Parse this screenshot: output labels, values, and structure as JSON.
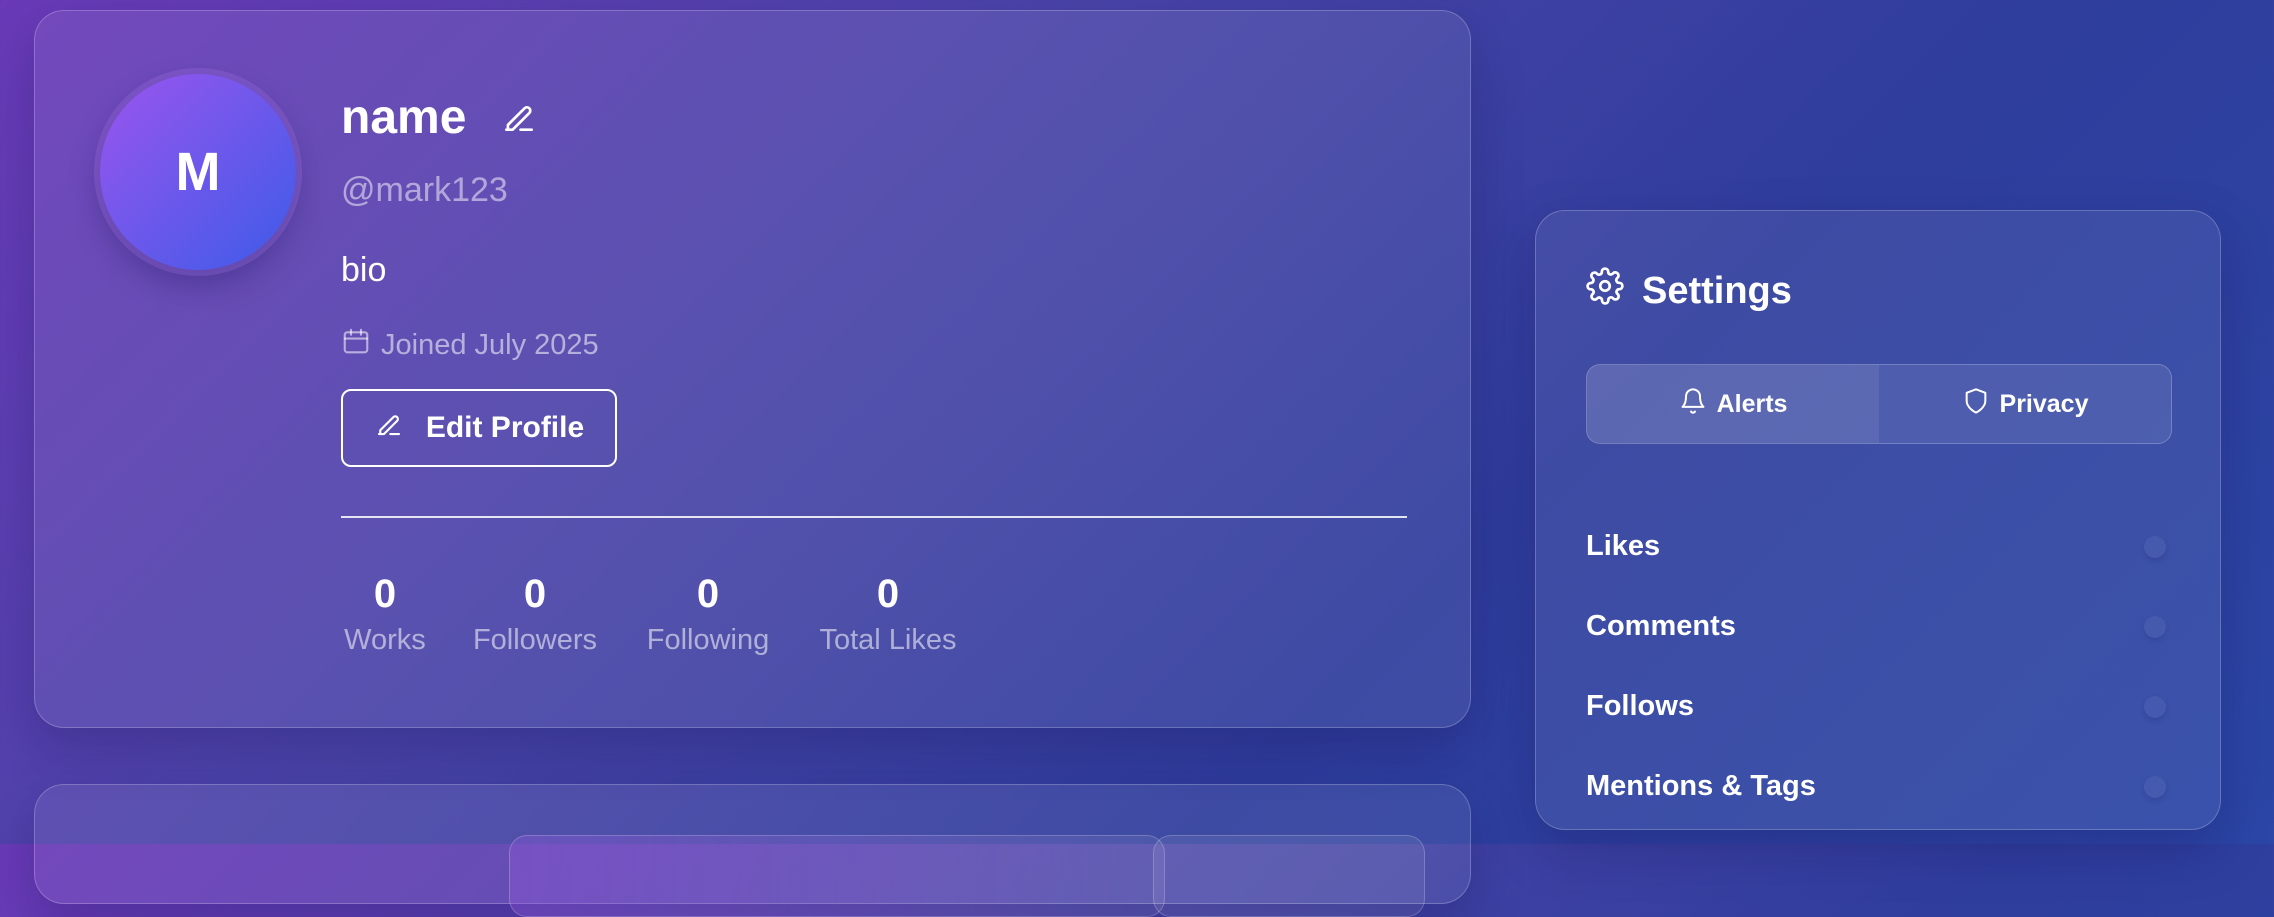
{
  "profile": {
    "avatar_initial": "M",
    "name": "name",
    "handle": "@mark123",
    "bio": "bio",
    "joined": "Joined July 2025",
    "edit_button": "Edit Profile",
    "stats": [
      {
        "value": "0",
        "label": "Works"
      },
      {
        "value": "0",
        "label": "Followers"
      },
      {
        "value": "0",
        "label": "Following"
      },
      {
        "value": "0",
        "label": "Total Likes"
      }
    ]
  },
  "settings": {
    "title": "Settings",
    "tabs": [
      {
        "label": "Alerts",
        "icon": "bell-icon"
      },
      {
        "label": "Privacy",
        "icon": "shield-icon"
      }
    ],
    "items": [
      {
        "label": "Likes"
      },
      {
        "label": "Comments"
      },
      {
        "label": "Follows"
      },
      {
        "label": "Mentions & Tags"
      }
    ]
  }
}
